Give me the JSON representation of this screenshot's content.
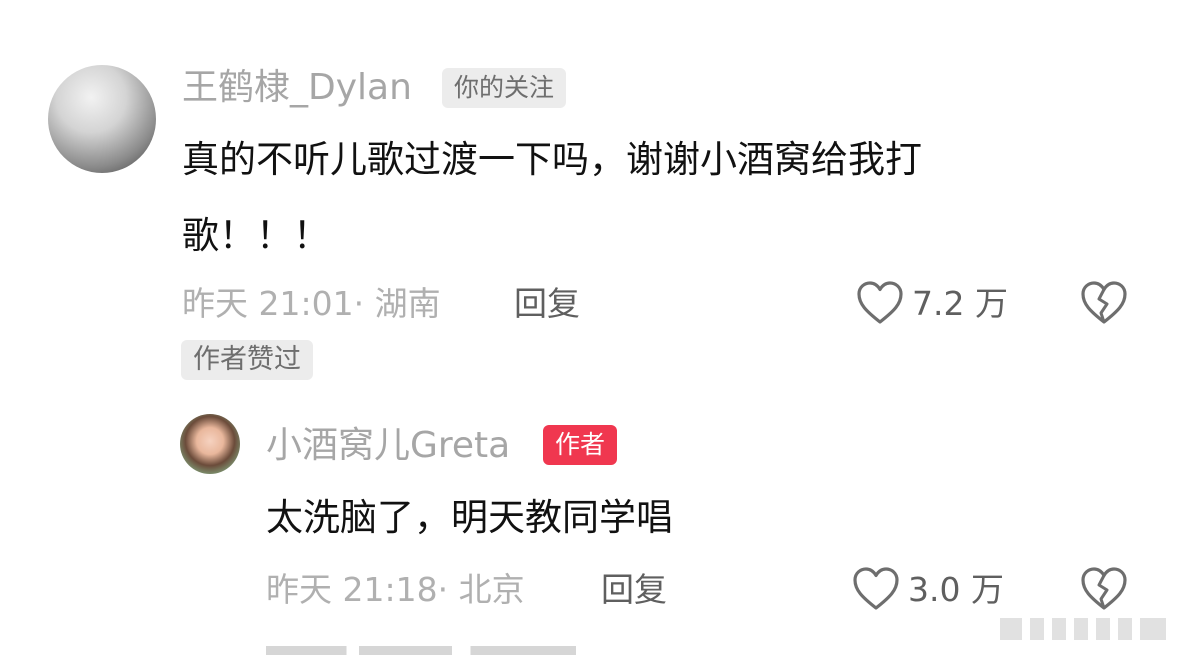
{
  "comment1": {
    "username": "王鹤棣_Dylan",
    "badge": "你的关注",
    "text_line1": "真的不听儿歌过渡一下吗，谢谢小酒窝给我打",
    "text_line2": "歌！！！",
    "time_location": "昨天 21:01· 湖南",
    "reply_label": "回复",
    "like_count": "7.2 万",
    "author_liked_tag": "作者赞过"
  },
  "reply1": {
    "username": "小酒窝儿Greta",
    "badge": "作者",
    "text": "太洗脑了，明天教同学唱",
    "time_location": "昨天 21:18· 北京",
    "reply_label": "回复",
    "like_count": "3.0 万"
  },
  "icons": {
    "like": "heart-outline-icon",
    "dislike": "broken-heart-icon"
  },
  "colors": {
    "author_badge": "#f0374f",
    "muted_text": "#a6a6a6",
    "body_text": "#111111"
  }
}
